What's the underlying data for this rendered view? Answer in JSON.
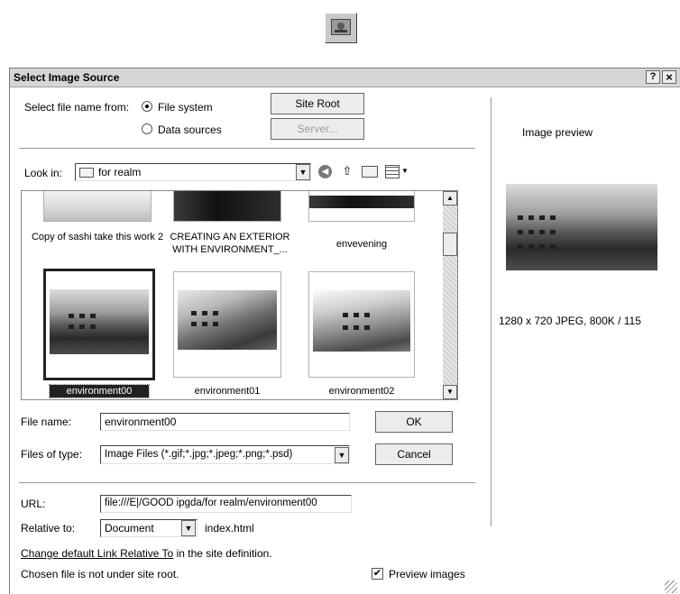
{
  "dialog": {
    "title": "Select Image Source",
    "help_label": "?",
    "close_label": "×"
  },
  "source": {
    "label": "Select file name from:",
    "option_file_system": "File system",
    "option_data_sources": "Data sources",
    "selected": "File system",
    "site_root_button": "Site Root",
    "server_button": "Server..."
  },
  "look_in": {
    "label": "Look in:",
    "folder": "for realm"
  },
  "files": [
    {
      "name": "Copy of sashi take this work 2",
      "selected": false
    },
    {
      "name": "CREATING AN EXTERIOR WITH ENVIRONMENT_...",
      "selected": false
    },
    {
      "name": "envevening",
      "selected": false
    },
    {
      "name": "environment00",
      "selected": true
    },
    {
      "name": "environment01",
      "selected": false
    },
    {
      "name": "environment02",
      "selected": false
    }
  ],
  "file_name": {
    "label": "File name:",
    "value": "environment00",
    "ok_button": "OK"
  },
  "files_of_type": {
    "label": "Files of type:",
    "value": "Image Files (*.gif;*.jpg;*.jpeg;*.png;*.psd)",
    "cancel_button": "Cancel"
  },
  "url": {
    "label": "URL:",
    "value": "file:///E|/GOOD ipgda/for realm/environment00"
  },
  "relative_to": {
    "label": "Relative to:",
    "value": "Document",
    "page": "index.html"
  },
  "link_text": "Change default Link Relative To",
  "link_suffix": " in the site definition.",
  "status_text": "Chosen file is not under site root.",
  "preview_checkbox": {
    "label": "Preview images",
    "checked": true
  },
  "preview": {
    "heading": "Image preview",
    "info": "1280 x 720 JPEG, 800K / 115"
  }
}
